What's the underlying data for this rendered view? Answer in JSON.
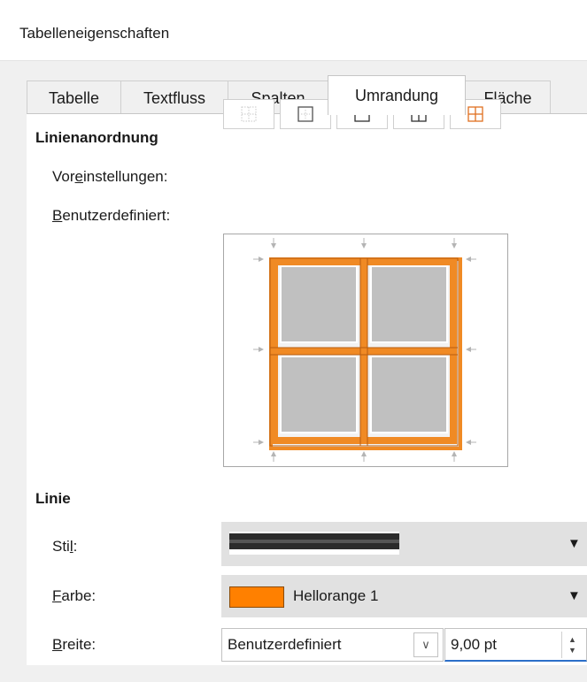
{
  "window": {
    "title": "Tabelleneigenschaften"
  },
  "tabs": [
    {
      "label": "Tabelle",
      "active": false
    },
    {
      "label": "Textfluss",
      "active": false
    },
    {
      "label": "Spalten",
      "active": false
    },
    {
      "label": "Umrandung",
      "active": true
    },
    {
      "label": "Fläche",
      "active": false
    }
  ],
  "line_arrangement": {
    "heading": "Linienanordnung",
    "presets_label_pre": "Vor",
    "presets_label_key": "e",
    "presets_label_post": "instellungen:",
    "presets": [
      {
        "icon": "border-none-icon"
      },
      {
        "icon": "border-outer-icon"
      },
      {
        "icon": "border-outer-horizontal-icon"
      },
      {
        "icon": "border-all-icon"
      },
      {
        "icon": "border-outer-all-inner-icon"
      }
    ],
    "custom_label_key": "B",
    "custom_label_post": "enutzerdefiniert:",
    "preview_border_color": "#f08a24",
    "preview_cell_color": "#c0c0c0"
  },
  "line": {
    "heading": "Linie",
    "style_label_pre": "Sti",
    "style_label_key": "l",
    "style_label_post": ":",
    "color_label_key": "F",
    "color_label_post": "arbe:",
    "color_value": "Hellorange 1",
    "color_swatch": "#ff8000",
    "width_label_key": "B",
    "width_label_post": "reite:",
    "width_preset": "Benutzerdefiniert",
    "width_value": "9,00 pt"
  }
}
